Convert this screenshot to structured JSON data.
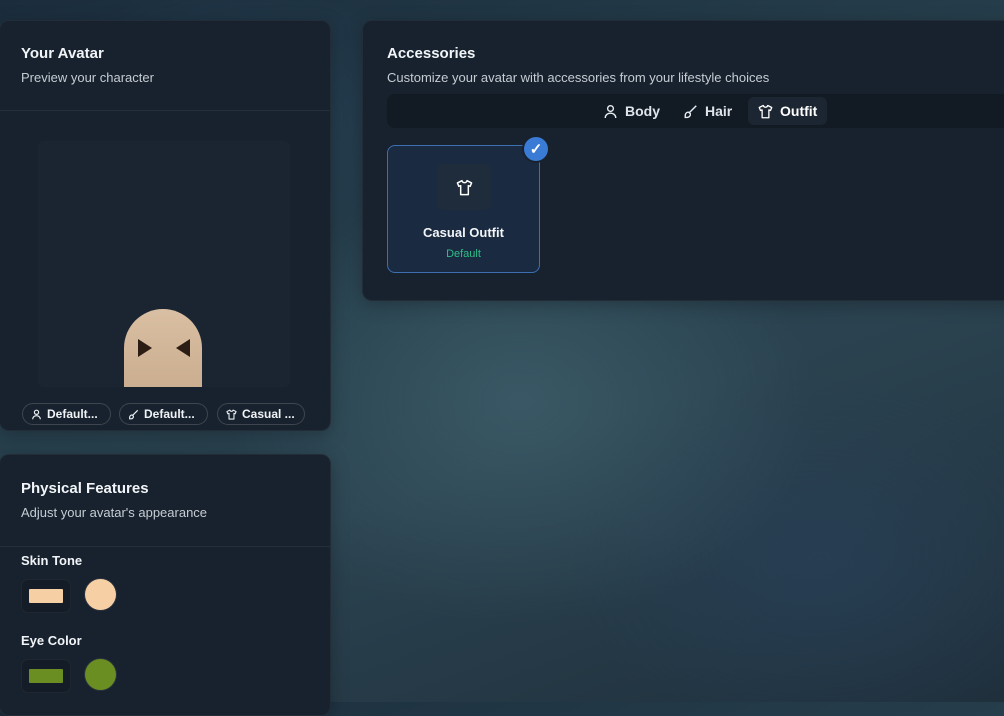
{
  "avatar_card": {
    "title": "Your Avatar",
    "subtitle": "Preview your character",
    "chips": [
      {
        "icon": "person-icon",
        "label": "Default..."
      },
      {
        "icon": "brush-icon",
        "label": "Default..."
      },
      {
        "icon": "shirt-icon",
        "label": "Casual ..."
      }
    ]
  },
  "physical_card": {
    "title": "Physical Features",
    "subtitle": "Adjust your avatar's appearance",
    "skin_tone": {
      "label": "Skin Tone",
      "color": "#f6cfa5"
    },
    "eye_color": {
      "label": "Eye Color",
      "color": "#6b8e23"
    }
  },
  "accessories_card": {
    "title": "Accessories",
    "subtitle": "Customize your avatar with accessories from your lifestyle choices",
    "tabs": [
      {
        "icon": "person-icon",
        "label": "Body",
        "active": false
      },
      {
        "icon": "brush-icon",
        "label": "Hair",
        "active": false
      },
      {
        "icon": "shirt-icon",
        "label": "Outfit",
        "active": true
      }
    ],
    "items": [
      {
        "icon": "shirt-icon",
        "name": "Casual Outfit",
        "status": "Default",
        "selected": true
      }
    ]
  },
  "colors": {
    "accent": "#3a7bd5",
    "status_green": "#2fbf8a",
    "card_bg": "#18222e"
  }
}
